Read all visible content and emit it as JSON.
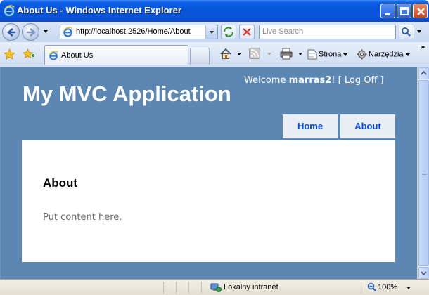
{
  "window": {
    "title": "About Us - Windows Internet Explorer"
  },
  "addressbar": {
    "url": "http://localhost:2526/Home/About",
    "search_placeholder": "Live Search"
  },
  "tabs": [
    {
      "label": "About Us"
    }
  ],
  "commandbar": {
    "page_label": "Strona",
    "tools_label": "Narzędzia"
  },
  "page": {
    "app_title": "My MVC Application",
    "login": {
      "welcome": "Welcome ",
      "username": "marras2",
      "exclaim": "! [ ",
      "logoff": "Log Off",
      "close_bracket": " ]"
    },
    "menu": [
      {
        "label": "Home"
      },
      {
        "label": "About"
      }
    ],
    "heading": "About",
    "body": "Put content here."
  },
  "statusbar": {
    "zone": "Lokalny intranet",
    "zoom": "100%"
  },
  "colors": {
    "page_bg": "#5c87b2",
    "menu_bg": "#e8eef4",
    "menu_text": "#034af3",
    "body_text": "#696969"
  }
}
